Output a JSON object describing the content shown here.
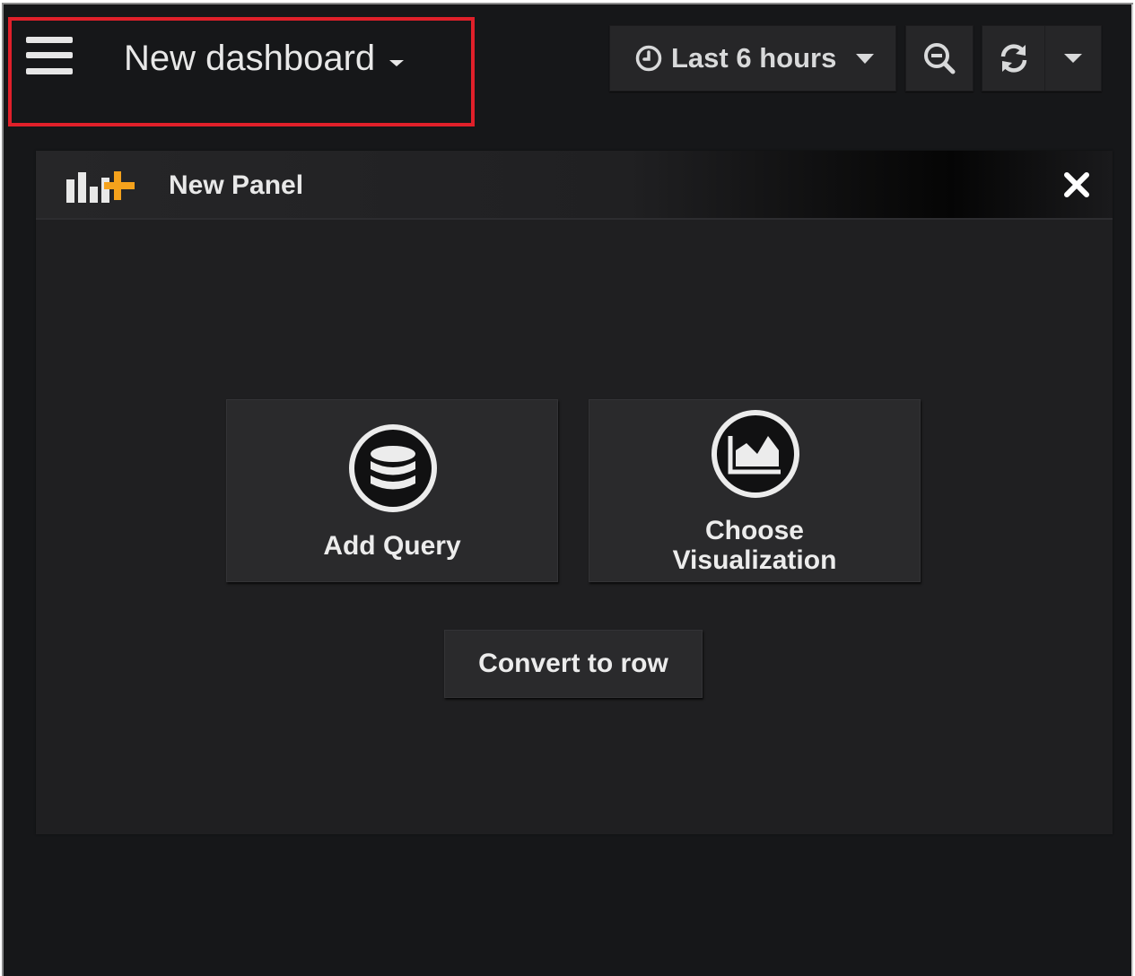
{
  "topbar": {
    "dashboard_title": "New dashboard",
    "time_range_label": "Last 6 hours",
    "menu_icon": "hamburger-menu-icon",
    "zoom_icon": "zoom-out-icon",
    "refresh_icon": "refresh-icon"
  },
  "panel": {
    "title": "New Panel",
    "icon": "add-panel-icon",
    "close_icon": "close-icon",
    "actions": {
      "add_query_label": "Add Query",
      "add_query_icon": "database-icon",
      "choose_viz_line1": "Choose",
      "choose_viz_line2": "Visualization",
      "choose_viz_icon": "area-chart-icon",
      "convert_row_label": "Convert to row"
    }
  },
  "colors": {
    "background": "#161719",
    "panel": "#1f1f21",
    "button": "#262628",
    "text": "#e8e8e8",
    "accent_orange": "#f5a21c",
    "highlight_red": "#e0202a"
  }
}
